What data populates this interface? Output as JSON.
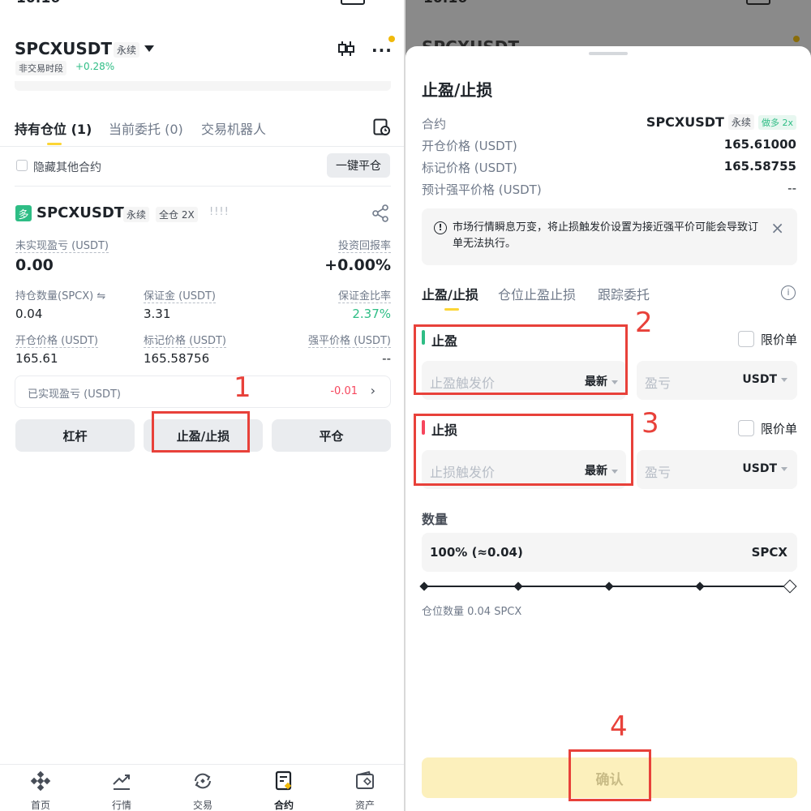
{
  "left": {
    "status_time": "10:16",
    "symbol": "SPCXUSDT",
    "contract_tag": "永续",
    "session": "非交易时段",
    "change": "+0.28%",
    "tabs": [
      "持有仓位 (1)",
      "当前委托 (0)",
      "交易机器人"
    ],
    "hide_other": "隐藏其他合约",
    "close_all": "一键平仓",
    "position": {
      "side_badge": "多",
      "symbol": "SPCXUSDT",
      "tag1": "永续",
      "tag2": "全仓 2X",
      "bars": "!!!!",
      "unrealized_label": "未实现盈亏 (USDT)",
      "unrealized_value": "0.00",
      "roi_label": "投资回报率",
      "roi_value": "+0.00%",
      "qty_label": "持仓数量(SPCX) ⇋",
      "qty_value": "0.04",
      "margin_label": "保证金 (USDT)",
      "margin_value": "3.31",
      "margin_ratio_label": "保证金比率",
      "margin_ratio_value": "2.37%",
      "entry_label": "开仓价格 (USDT)",
      "entry_value": "165.61",
      "mark_label": "标记价格 (USDT)",
      "mark_value": "165.58756",
      "liq_label": "强平价格 (USDT)",
      "liq_value": "--",
      "realized_label": "已实现盈亏 (USDT)",
      "realized_value": "-0.01"
    },
    "buttons": {
      "leverage": "杠杆",
      "tpsl": "止盈/止损",
      "close": "平仓"
    },
    "nav": [
      "首页",
      "行情",
      "交易",
      "合约",
      "资产"
    ]
  },
  "right": {
    "status_time": "10:16",
    "title": "止盈/止损",
    "contract_label": "合约",
    "contract_symbol": "SPCXUSDT",
    "contract_tag": "永续",
    "contract_side": "做多 2x",
    "entry_label": "开仓价格 (USDT)",
    "entry_value": "165.61000",
    "mark_label": "标记价格 (USDT)",
    "mark_value": "165.58755",
    "liq_label": "预计强平价格 (USDT)",
    "liq_value": "--",
    "warning": "市场行情瞬息万变，将止损触发价设置为接近强平价可能会导致订单无法执行。",
    "tabs": [
      "止盈/止损",
      "仓位止盈止损",
      "跟踪委托"
    ],
    "tp": {
      "label": "止盈",
      "limit": "限价单",
      "trigger_placeholder": "止盈触发价",
      "price_type": "最新",
      "pnl_placeholder": "盈亏",
      "unit": "USDT"
    },
    "sl": {
      "label": "止损",
      "limit": "限价单",
      "trigger_placeholder": "止损触发价",
      "price_type": "最新",
      "pnl_placeholder": "盈亏",
      "unit": "USDT"
    },
    "qty_label": "数量",
    "qty_value": "100% (≈0.04)",
    "qty_unit": "SPCX",
    "slider_value": 1.0,
    "position_qty": "仓位数量 0.04 SPCX",
    "confirm": "确认"
  },
  "annotations": [
    "1",
    "2",
    "3",
    "4"
  ],
  "colors": {
    "brand": "#fcd535",
    "green": "#2ebd85",
    "red": "#f6465d",
    "annotation": "#e8413a"
  }
}
